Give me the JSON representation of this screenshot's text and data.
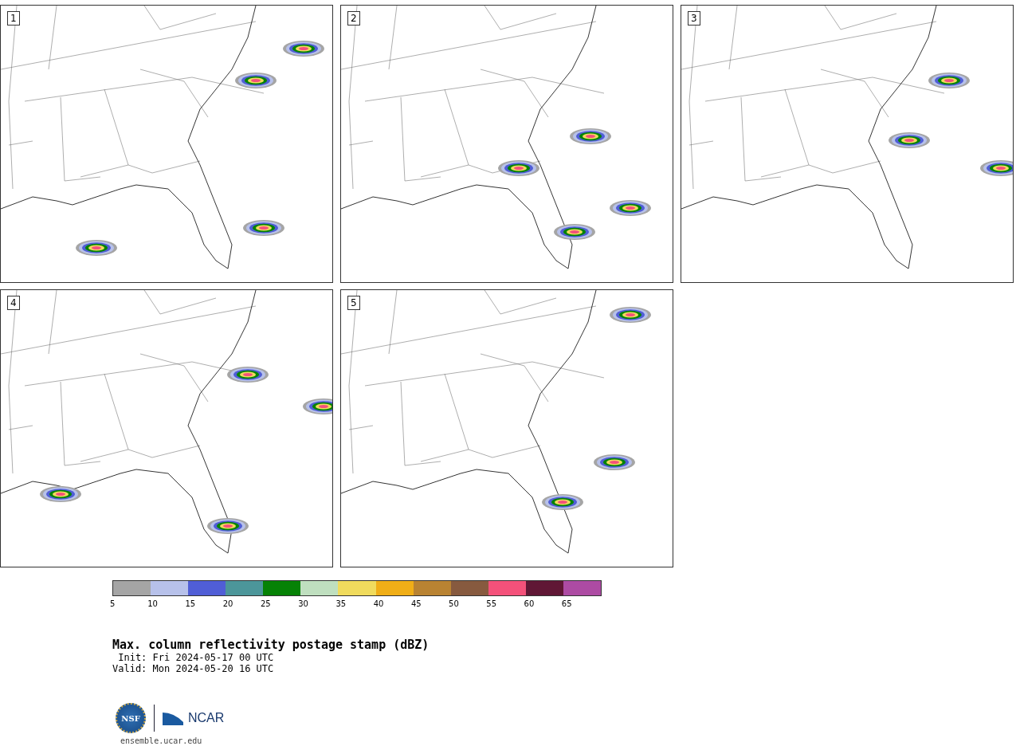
{
  "panels": [
    {
      "label": "1"
    },
    {
      "label": "2"
    },
    {
      "label": "3"
    },
    {
      "label": "4"
    },
    {
      "label": "5"
    }
  ],
  "colorbar": {
    "segments": [
      {
        "color": "#a5a5a5",
        "tick": "5"
      },
      {
        "color": "#b7c1ea",
        "tick": "10"
      },
      {
        "color": "#505ed6",
        "tick": "15"
      },
      {
        "color": "#4c969a",
        "tick": "20"
      },
      {
        "color": "#068206",
        "tick": "25"
      },
      {
        "color": "#bfdfbf",
        "tick": "30"
      },
      {
        "color": "#f0db5d",
        "tick": "35"
      },
      {
        "color": "#f0ae17",
        "tick": "40"
      },
      {
        "color": "#b98332",
        "tick": "45"
      },
      {
        "color": "#875a3f",
        "tick": "50"
      },
      {
        "color": "#f4517a",
        "tick": "55"
      },
      {
        "color": "#601735",
        "tick": "60"
      },
      {
        "color": "#ad4ba3",
        "tick": "65"
      }
    ]
  },
  "title": "Max. column reflectivity postage stamp (dBZ)",
  "init": " Init: Fri 2024-05-17 00 UTC",
  "valid": "Valid: Mon 2024-05-20 16 UTC",
  "logos": {
    "left": "NSF",
    "right": "NCAR"
  },
  "footer": "ensemble.ucar.edu"
}
